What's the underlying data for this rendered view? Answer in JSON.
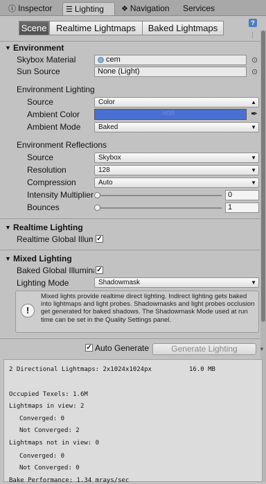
{
  "tabs": [
    {
      "label": "Inspector",
      "icon": "info-icon"
    },
    {
      "label": "Lighting",
      "icon": "lighting-icon"
    },
    {
      "label": "Navigation",
      "icon": "navigation-icon"
    },
    {
      "label": "Services",
      "icon": ""
    }
  ],
  "modes": [
    "Scene",
    "Realtime Lightmaps",
    "Baked Lightmaps"
  ],
  "environment": {
    "header": "Environment",
    "skybox_label": "Skybox Material",
    "skybox_value": "cem",
    "sun_label": "Sun Source",
    "sun_value": "None (Light)",
    "env_lighting_title": "Environment Lighting",
    "source_label": "Source",
    "source_value": "Color",
    "ambient_color_label": "Ambient Color",
    "ambient_color_hex": "#4a6fd0",
    "ambient_mode_label": "Ambient Mode",
    "ambient_mode_value": "Baked",
    "env_reflections_title": "Environment Reflections",
    "refl_source_label": "Source",
    "refl_source_value": "Skybox",
    "resolution_label": "Resolution",
    "resolution_value": "128",
    "compression_label": "Compression",
    "compression_value": "Auto",
    "intensity_label": "Intensity Multiplier",
    "intensity_value": "0",
    "bounces_label": "Bounces",
    "bounces_value": "1"
  },
  "realtime": {
    "header": "Realtime Lighting",
    "gi_label": "Realtime Global Illumination",
    "gi_checked": true
  },
  "mixed": {
    "header": "Mixed Lighting",
    "baked_gi_label": "Baked Global Illumination",
    "baked_gi_checked": true,
    "mode_label": "Lighting Mode",
    "mode_value": "Shadowmask",
    "help_text": "Mixed lights provide realtime direct lighting. Indirect lighting gets baked into lightmaps and light probes. Shadowmasks and light probes occlusion get generated for baked shadows. The Shadowmask Mode used at run time can be set in the Quality Settings panel."
  },
  "generate": {
    "auto_label": "Auto Generate",
    "auto_checked": true,
    "button_label": "Generate Lighting"
  },
  "stats": {
    "directional": "2 Directional Lightmaps: 2x1024x1024px",
    "size": "16.0 MB",
    "occupied": "Occupied Texels: 1.6M",
    "in_view": "Lightmaps in view: 2",
    "in_view_converged": "Converged: 0",
    "in_view_not_converged": "Not Converged: 2",
    "not_in_view": "Lightmaps not in view: 0",
    "not_in_view_converged": "Converged: 0",
    "not_in_view_not_converged": "Not Converged: 0",
    "bake_perf": "Bake Performance: 1.34 mrays/sec"
  }
}
